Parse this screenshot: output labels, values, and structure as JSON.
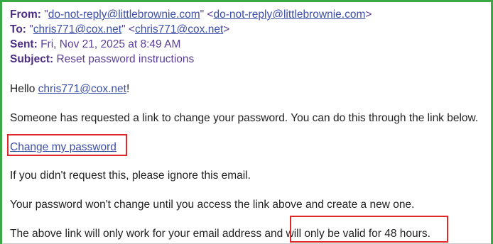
{
  "email": {
    "header": {
      "from_label": "From:",
      "from_name": "do-not-reply@littlebrownie.com",
      "from_address": "do-not-reply@littlebrownie.com",
      "to_label": "To:",
      "to_name": "chris771@cox.net",
      "to_address": "chris771@cox.net",
      "sent_label": "Sent:",
      "sent_value": "Fri, Nov 21, 2025 at 8:49 AM",
      "subject_label": "Subject:",
      "subject_value": "Reset password instructions"
    },
    "body": {
      "greeting_prefix": "Hello ",
      "greeting_email": "chris771@cox.net",
      "greeting_suffix": "!",
      "line1": "Someone has requested a link to change your password. You can do this through the link below.",
      "link_text": "Change my password",
      "line2": "If you didn't request this, please ignore this email.",
      "line3": "Your password won't change until you access the link above and create a new one.",
      "line4_part1": "The above link will only work for your email address and ",
      "line4_part2": "will only be valid for 48 hours."
    }
  },
  "colors": {
    "frame_green": "#3aa845",
    "highlight_red": "#e0282a",
    "header_purple": "#5b3e96",
    "link_blue": "#3d4fa8"
  }
}
